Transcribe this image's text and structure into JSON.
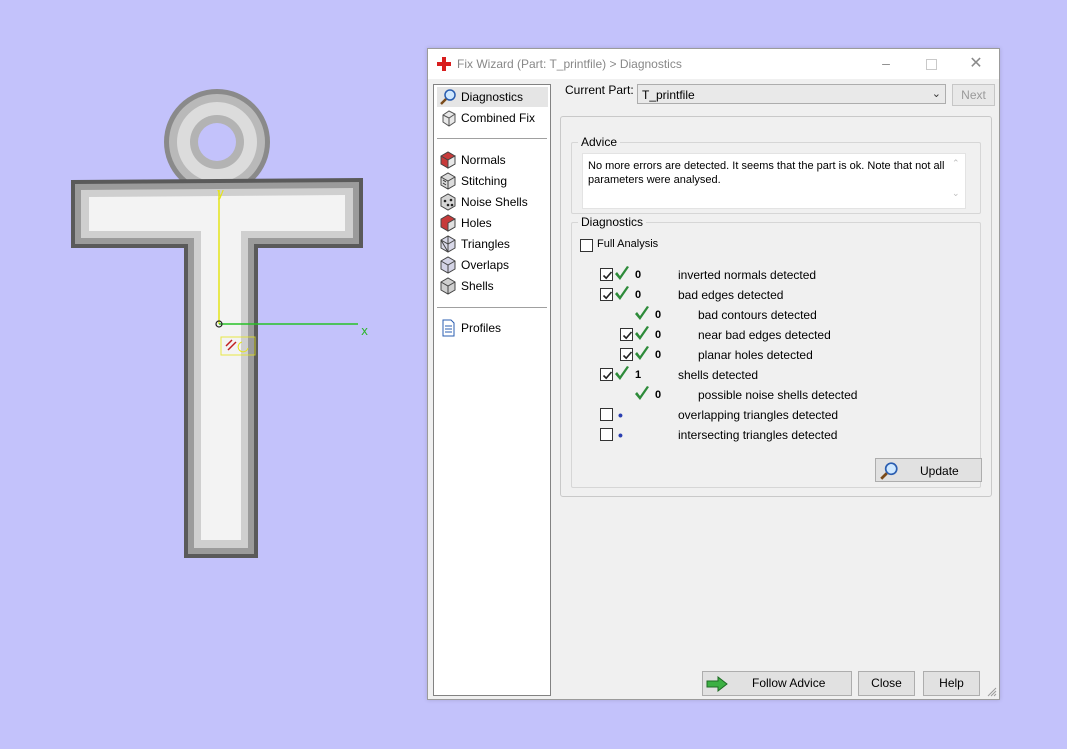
{
  "viewport": {
    "axis_x_label": "x",
    "axis_y_label": "y",
    "axis_colors": {
      "x": "#27c227",
      "y": "#e4e41a"
    }
  },
  "dialog": {
    "title": "Fix Wizard (Part: T_printfile) > Diagnostics",
    "title_icon": "red-cross-icon",
    "controls": [
      "minimize-icon",
      "maximize-icon",
      "close-icon"
    ]
  },
  "nav": {
    "items": [
      {
        "label": "Diagnostics",
        "icon": "magnifier-icon",
        "selected": true
      },
      {
        "label": "Combined Fix",
        "icon": "combined-fix-icon"
      },
      {
        "label": "Normals",
        "icon": "normals-icon"
      },
      {
        "label": "Stitching",
        "icon": "stitching-icon"
      },
      {
        "label": "Noise Shells",
        "icon": "noise-shells-icon"
      },
      {
        "label": "Holes",
        "icon": "holes-icon"
      },
      {
        "label": "Triangles",
        "icon": "triangles-icon"
      },
      {
        "label": "Overlaps",
        "icon": "overlaps-icon"
      },
      {
        "label": "Shells",
        "icon": "shells-icon"
      },
      {
        "label": "Profiles",
        "icon": "document-icon"
      }
    ]
  },
  "current_part": {
    "label": "Current Part:",
    "value": "T_printfile"
  },
  "next_label": "Next",
  "advice": {
    "title": "Advice",
    "text": "No more errors are detected. It seems that the part is ok. Note that not all parameters were analysed."
  },
  "diagnostics": {
    "title": "Diagnostics",
    "full_analysis_label": "Full Analysis",
    "full_analysis_checked": false,
    "rows": [
      {
        "checkbox": true,
        "checked": true,
        "status": "ok",
        "count": "0",
        "label": "inverted normals detected",
        "indent": 0
      },
      {
        "checkbox": true,
        "checked": true,
        "status": "ok",
        "count": "0",
        "label": "bad edges detected",
        "indent": 0
      },
      {
        "checkbox": false,
        "checked": false,
        "status": "ok",
        "count": "0",
        "label": "bad contours detected",
        "indent": 1
      },
      {
        "checkbox": true,
        "checked": true,
        "status": "ok",
        "count": "0",
        "label": "near bad edges detected",
        "indent": 1
      },
      {
        "checkbox": true,
        "checked": true,
        "status": "ok",
        "count": "0",
        "label": "planar holes detected",
        "indent": 1
      },
      {
        "checkbox": true,
        "checked": true,
        "status": "ok",
        "count": "1",
        "label": "shells detected",
        "indent": 0
      },
      {
        "checkbox": false,
        "checked": false,
        "status": "ok",
        "count": "0",
        "label": "possible noise shells detected",
        "indent": 1
      },
      {
        "checkbox": true,
        "checked": false,
        "status": "pending",
        "count": "•",
        "label": "overlapping triangles detected",
        "indent": 0
      },
      {
        "checkbox": true,
        "checked": false,
        "status": "pending",
        "count": "•",
        "label": "intersecting triangles detected",
        "indent": 0
      }
    ],
    "update_label": "Update"
  },
  "buttons": {
    "follow_advice": "Follow Advice",
    "close": "Close",
    "help": "Help"
  },
  "colors": {
    "background": "#c3c2fb",
    "ok_check": "#2e8b3a",
    "follow_arrow": "#3cb043"
  }
}
